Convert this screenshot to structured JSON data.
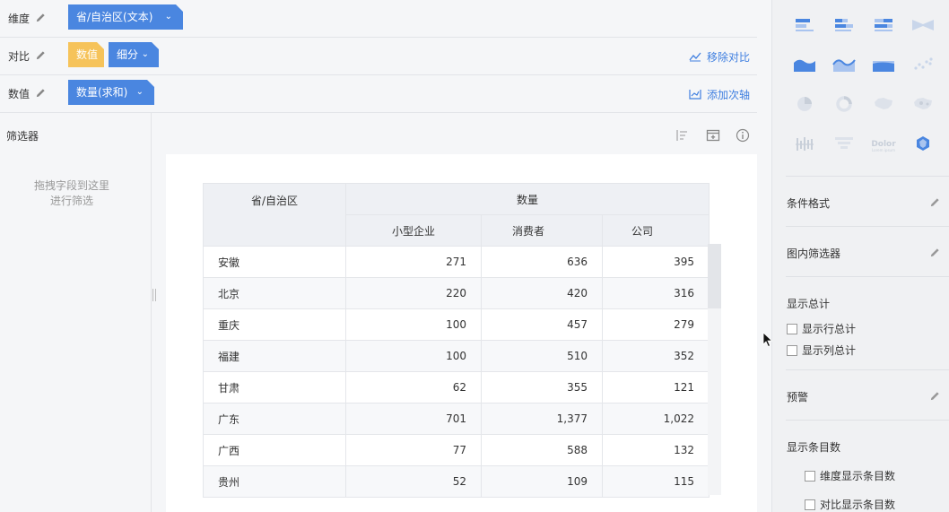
{
  "config": {
    "dimension": {
      "label": "维度",
      "chip": "省/自治区(文本)"
    },
    "compare": {
      "label": "对比",
      "chip_value": "数值",
      "chip_detail": "细分",
      "action": "移除对比"
    },
    "value": {
      "label": "数值",
      "chip": "数量(求和)",
      "action": "添加次轴"
    }
  },
  "filter": {
    "title": "筛选器",
    "hint_line1": "拖拽字段到这里",
    "hint_line2": "进行筛选"
  },
  "table": {
    "row_header": "省/自治区",
    "group_header": "数量",
    "columns": [
      "小型企业",
      "消费者",
      "公司"
    ],
    "rows": [
      {
        "name": "安徽",
        "values": [
          "271",
          "636",
          "395"
        ]
      },
      {
        "name": "北京",
        "values": [
          "220",
          "420",
          "316"
        ]
      },
      {
        "name": "重庆",
        "values": [
          "100",
          "457",
          "279"
        ]
      },
      {
        "name": "福建",
        "values": [
          "100",
          "510",
          "352"
        ]
      },
      {
        "name": "甘肃",
        "values": [
          "62",
          "355",
          "121"
        ]
      },
      {
        "name": "广东",
        "values": [
          "701",
          "1,377",
          "1,022"
        ]
      },
      {
        "name": "广西",
        "values": [
          "77",
          "588",
          "132"
        ]
      },
      {
        "name": "贵州",
        "values": [
          "52",
          "109",
          "115"
        ]
      }
    ]
  },
  "right_panel": {
    "chart_types": [
      [
        "bar-horizontal-icon",
        "bar-stacked-horizontal-icon",
        "bar-percent-horizontal-icon",
        "compare-bar-icon"
      ],
      [
        "area-icon",
        "area-stream-icon",
        "area-stacked-icon",
        "scatter-icon"
      ],
      [
        "pie-icon",
        "ring-icon",
        "map-icon",
        "map-bubble-icon"
      ],
      [
        "range-bar-icon",
        "funnel-icon",
        "word-cloud-icon",
        "gauge-icon"
      ]
    ],
    "word_cloud_text": {
      "line1": "Dolor",
      "line2": "Lorem ipsum"
    },
    "conditional_format": "条件格式",
    "inner_filter": "图内筛选器",
    "show_total": "显示总计",
    "show_row_total": "显示行总计",
    "show_col_total": "显示列总计",
    "warning": "预警",
    "show_item_count": "显示条目数",
    "dim_item_count": "维度显示条目数",
    "cmp_item_count": "对比显示条目数"
  },
  "colors": {
    "accent": "#4a86e0",
    "accent_orange": "#f6c35a",
    "link": "#3f7fe0",
    "icon_light": "#a9c4ef",
    "icon_dark": "#6b9ce6"
  }
}
